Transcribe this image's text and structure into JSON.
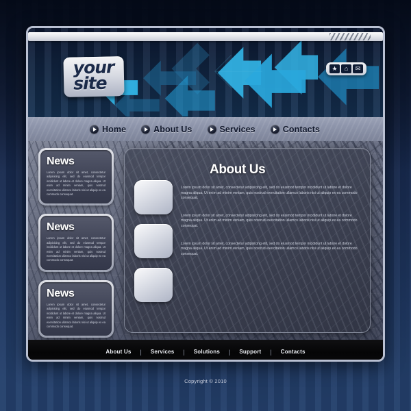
{
  "backdrop": {
    "base_color": "#16274a",
    "accent_color": "#24406c"
  },
  "header": {
    "logo": {
      "line1": "your",
      "line2": "site"
    },
    "icons": [
      {
        "name": "favorite-star-icon",
        "glyph": "★"
      },
      {
        "name": "home-icon",
        "glyph": "⌂"
      },
      {
        "name": "mail-envelope-icon",
        "glyph": "✉"
      }
    ],
    "arrow_color_light": "#2fb6e8",
    "arrow_color_dark": "#1b5f8c"
  },
  "nav": {
    "items": [
      {
        "label": "Home"
      },
      {
        "label": "About Us"
      },
      {
        "label": "Services"
      },
      {
        "label": "Contacts"
      }
    ]
  },
  "news": {
    "cards": [
      {
        "title": "News",
        "text": "Lorem ipsum dolor sit amet, consectetur adipisicing elit, sed do eiusmod tempor incididunt ut labore et dolore magna aliqua. Ut enim ad minim veniam, quis nostrud exercitation ullamco laboris nisi ut aliquip ex ea commodo consequat."
      },
      {
        "title": "News",
        "text": "Lorem ipsum dolor sit amet, consectetur adipisicing elit, sed do eiusmod tempor incididunt ut labore et dolore magna aliqua. Ut enim ad minim veniam, quis nostrud exercitation ullamco laboris nisi ut aliquip ex ea commodo consequat."
      },
      {
        "title": "News",
        "text": "Lorem ipsum dolor sit amet, consectetur adipisicing elit, sed do eiusmod tempor incididunt ut labore et dolore magna aliqua. Ut enim ad minim veniam, quis nostrud exercitation ullamco laboris nisi ut aliquip ex ea commodo consequat."
      }
    ]
  },
  "main": {
    "title": "About Us",
    "paragraphs": [
      "Lorem ipsum dolor sit amet, consectetur adipisicing elit, sed do eiusmod tempor incididunt ut labore et dolore magna aliqua. Ut enim ad minim veniam, quis nostrud exercitation ullamco laboris nisi ut aliquip ex ea commodo consequat.",
      "Lorem ipsum dolor sit amet, consectetur adipisicing elit, sed do eiusmod tempor incididunt ut labore et dolore magna aliqua. Ut enim ad minim veniam, quis nostrud exercitation ullamco laboris nisi ut aliquip ex ea commodo consequat.",
      "Lorem ipsum dolor sit amet, consectetur adipisicing elit, sed do eiusmod tempor incididunt ut labore et dolore magna aliqua. Ut enim ad minim veniam, quis nostrud exercitation ullamco laboris nisi ut aliquip ex ea commodo consequat."
    ],
    "thumbnails": [
      {
        "name": "image-placeholder-1"
      },
      {
        "name": "image-placeholder-2"
      },
      {
        "name": "image-placeholder-3"
      }
    ]
  },
  "footer": {
    "links": [
      {
        "label": "About Us"
      },
      {
        "label": "Services"
      },
      {
        "label": "Solutions"
      },
      {
        "label": "Support"
      },
      {
        "label": "Contacts"
      }
    ],
    "separator": "|"
  },
  "copyright": {
    "text": "Copyright © 2010"
  }
}
